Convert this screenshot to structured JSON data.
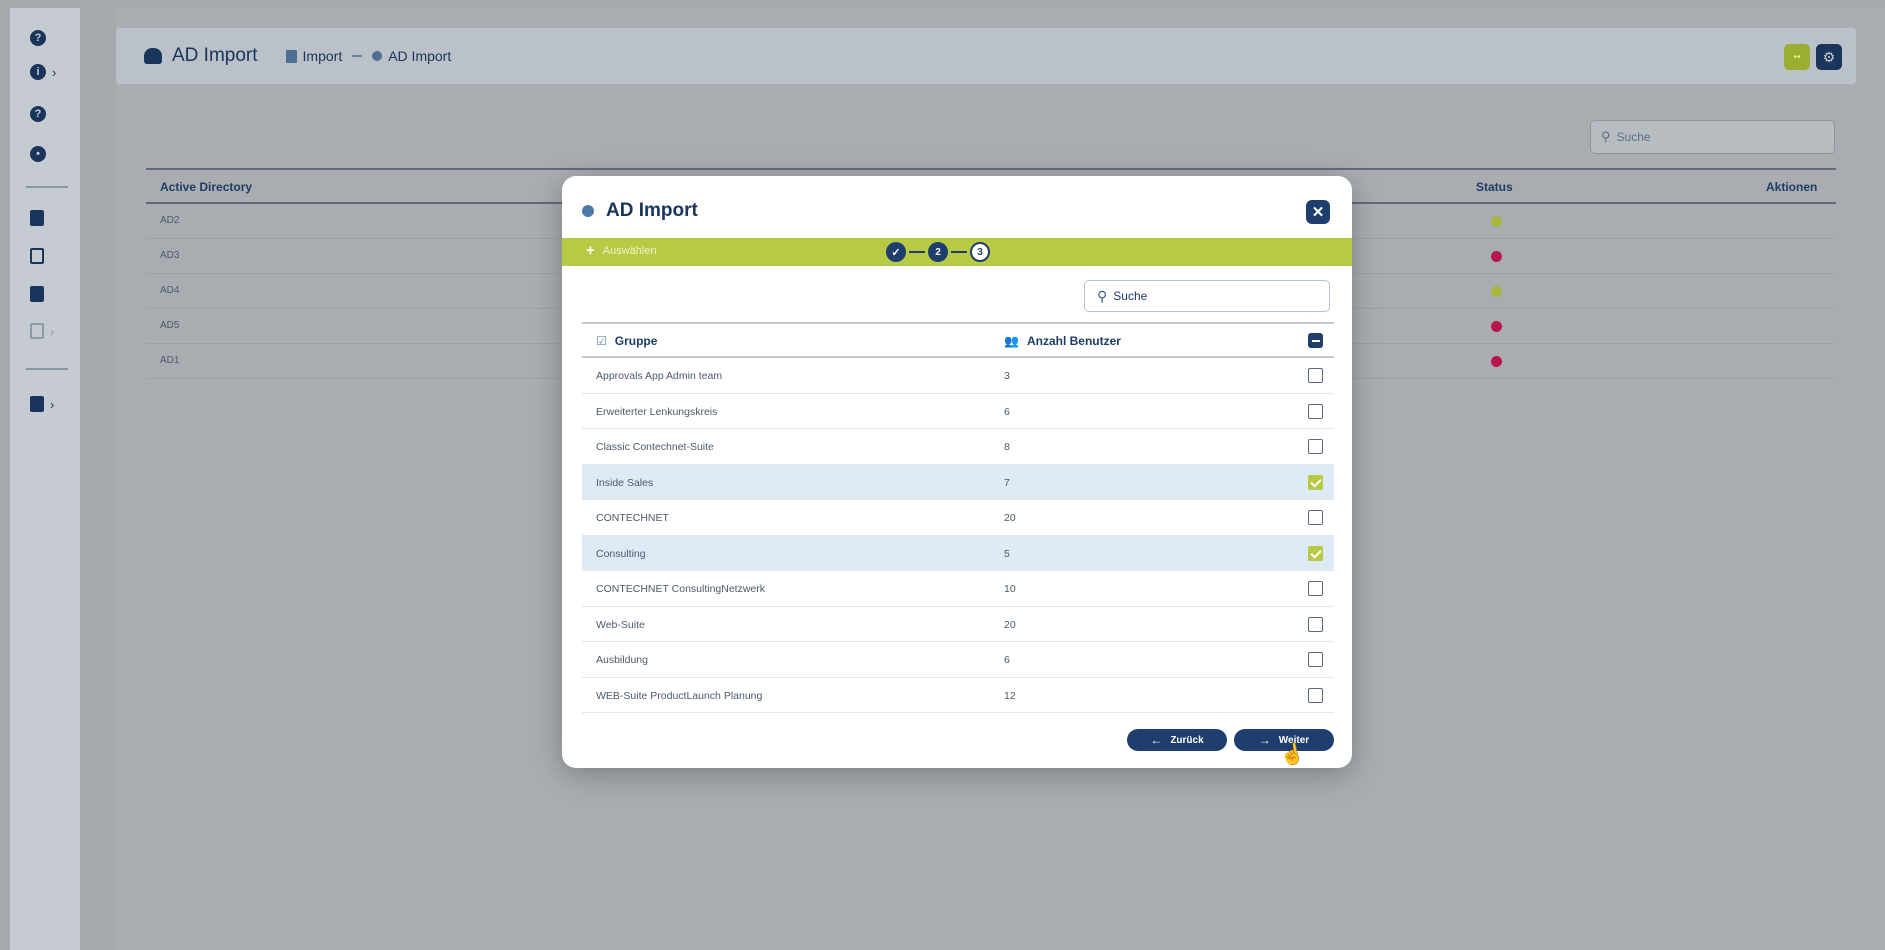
{
  "rail": {
    "items": [
      {
        "icon": "help-circle-icon",
        "glyph": "?"
      },
      {
        "icon": "info-circle-icon",
        "glyph": "i",
        "chevron": "›"
      },
      {
        "icon": "help-circle-icon",
        "glyph": "?"
      },
      {
        "icon": "clock-icon",
        "glyph": "•"
      },
      {
        "icon": "building-icon"
      },
      {
        "icon": "calendar-icon"
      },
      {
        "icon": "document-icon"
      },
      {
        "icon": "list-icon",
        "chevron": "›"
      },
      {
        "icon": "database-icon",
        "chevron": "›"
      }
    ]
  },
  "topbar": {
    "title": "AD Import",
    "breadcrumb": [
      "Import",
      "AD Import"
    ],
    "green_button_label": "••",
    "settings_glyph": "⚙"
  },
  "background": {
    "search_placeholder": "Suche",
    "columns": {
      "active_directory": "Active Directory",
      "status": "Status",
      "actions": "Aktionen"
    },
    "rows": [
      {
        "ad": "AD2",
        "status_color": "#a7b63d"
      },
      {
        "ad": "AD3",
        "status_color": "#b5174a"
      },
      {
        "ad": "AD4",
        "status_color": "#a7b63d"
      },
      {
        "ad": "AD5",
        "status_color": "#b5174a"
      },
      {
        "ad": "AD1",
        "status_color": "#b5174a"
      }
    ]
  },
  "modal": {
    "title": "AD Import",
    "close_glyph": "✕",
    "band_label": "Auswählen",
    "steps": [
      {
        "label": "✓",
        "state": "done"
      },
      {
        "label": "2",
        "state": "active"
      },
      {
        "label": "3",
        "state": "pending"
      }
    ],
    "search_placeholder": "Suche",
    "columns": {
      "group": "Gruppe",
      "users": "Anzahl Benutzer"
    },
    "rows": [
      {
        "group": "Approvals App Admin team",
        "users": "3",
        "checked": false
      },
      {
        "group": "Erweiterter Lenkungskreis",
        "users": "6",
        "checked": false
      },
      {
        "group": "Classic Contechnet-Suite",
        "users": "8",
        "checked": false
      },
      {
        "group": "Inside Sales",
        "users": "7",
        "checked": true
      },
      {
        "group": "CONTECHNET",
        "users": "20",
        "checked": false
      },
      {
        "group": "Consulting",
        "users": "5",
        "checked": true
      },
      {
        "group": "CONTECHNET ConsultingNetzwerk",
        "users": "10",
        "checked": false
      },
      {
        "group": "Web-Suite",
        "users": "20",
        "checked": false
      },
      {
        "group": "Ausbildung",
        "users": "6",
        "checked": false
      },
      {
        "group": "WEB-Suite ProductLaunch Planung",
        "users": "12",
        "checked": false
      }
    ],
    "back_label": "Zurück",
    "next_label": "Weiter"
  },
  "colors": {
    "accent": "#b8c946",
    "primary": "#1e3f6e",
    "selected_row": "#deeaf5"
  }
}
